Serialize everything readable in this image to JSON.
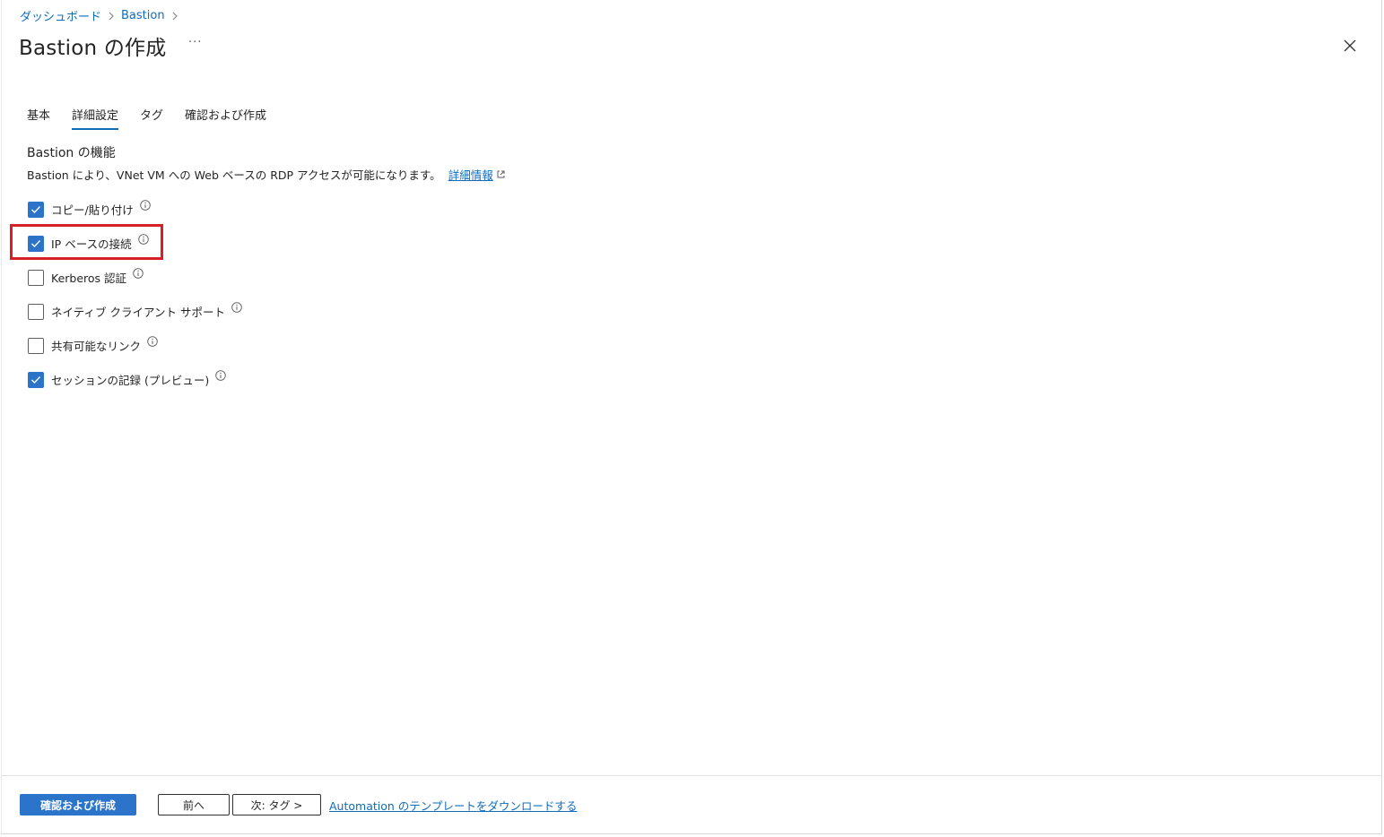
{
  "breadcrumb": {
    "items": [
      "ダッシュボード",
      "Bastion"
    ]
  },
  "header": {
    "title": "Bastion の作成",
    "more": "···"
  },
  "tabs": [
    {
      "label": "基本",
      "active": false
    },
    {
      "label": "詳細設定",
      "active": true
    },
    {
      "label": "タグ",
      "active": false
    },
    {
      "label": "確認および作成",
      "active": false
    }
  ],
  "section": {
    "title": "Bastion の機能",
    "description": "Bastion により、VNet VM への Web ベースの RDP アクセスが可能になります。",
    "learn_more": "詳細情報"
  },
  "options": [
    {
      "label": "コピー/貼り付け",
      "checked": true
    },
    {
      "label": "IP ベースの接続",
      "checked": true
    },
    {
      "label": "Kerberos 認証",
      "checked": false
    },
    {
      "label": "ネイティブ クライアント サポート",
      "checked": false
    },
    {
      "label": "共有可能なリンク",
      "checked": false
    },
    {
      "label": "セッションの記録 (プレビュー)",
      "checked": true
    }
  ],
  "footer": {
    "review_create": "確認および作成",
    "previous": "前へ",
    "next": "次: タグ >",
    "download_template": "Automation のテンプレートをダウンロードする"
  },
  "colors": {
    "accent": "#0f6cbd",
    "primary_button": "#2b74c9",
    "highlight": "#d61f26"
  }
}
